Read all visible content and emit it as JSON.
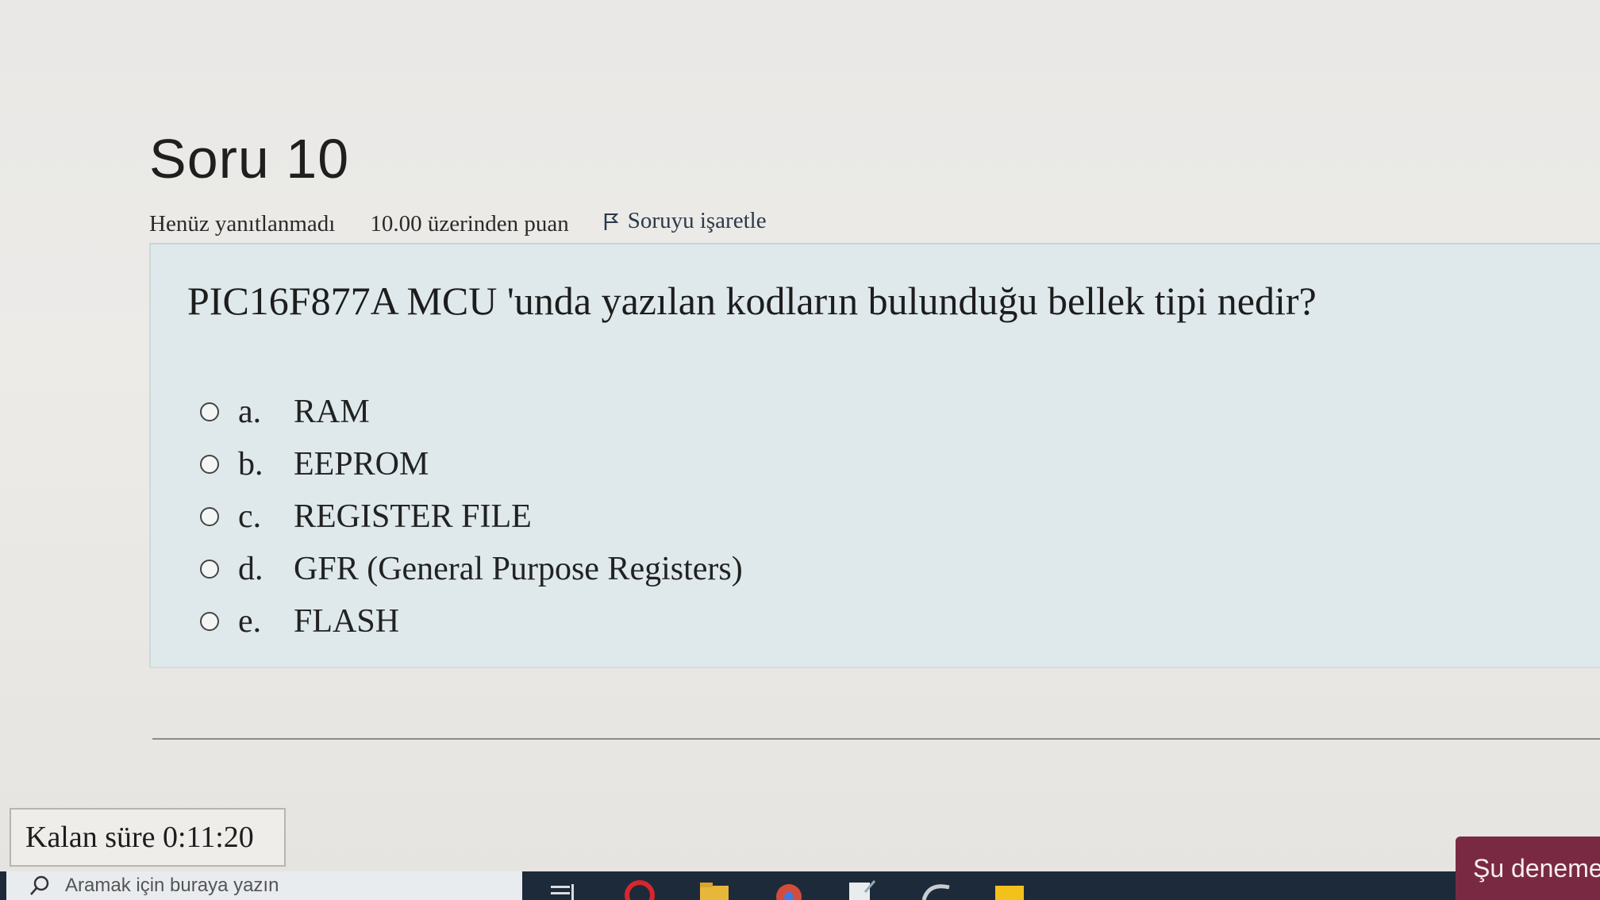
{
  "question": {
    "title": "Soru 10",
    "status": "Henüz yanıtlanmadı",
    "points": "10.00 üzerinden puan",
    "flag_label": "Soruyu işaretle",
    "text": "PIC16F877A MCU 'unda yazılan kodların bulunduğu bellek tipi nedir?",
    "answers": [
      {
        "letter": "a.",
        "label": "RAM"
      },
      {
        "letter": "b.",
        "label": "EEPROM"
      },
      {
        "letter": "c.",
        "label": "REGISTER FILE"
      },
      {
        "letter": "d.",
        "label": "GFR (General Purpose Registers)"
      },
      {
        "letter": "e.",
        "label": "FLASH"
      }
    ]
  },
  "timer": {
    "label": "Kalan süre 0:11:20"
  },
  "attempt_button": {
    "label": "Şu deneme"
  },
  "taskbar": {
    "search_placeholder": "Aramak için buraya yazın",
    "icons": [
      "task-view-icon",
      "opera-icon",
      "file-explorer-icon",
      "chrome-icon",
      "notepad-icon",
      "edge-icon",
      "sticky-notes-icon"
    ]
  },
  "colors": {
    "question_box_bg": "#dfe9ec",
    "attempt_button_bg": "#7a2942",
    "taskbar_bg": "#1d2a3a"
  }
}
